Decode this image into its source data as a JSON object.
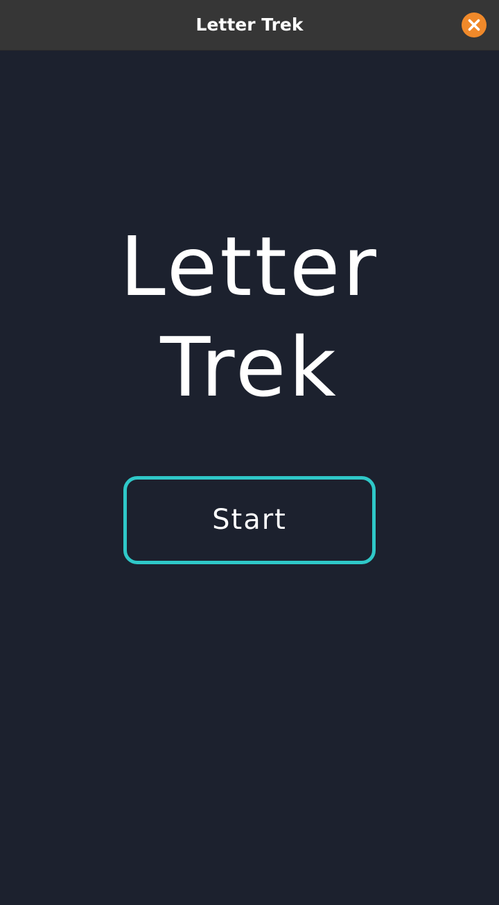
{
  "window": {
    "title": "Letter Trek",
    "close_icon": "close-icon",
    "close_color": "#f0892a"
  },
  "game": {
    "title_line1": "Letter",
    "title_line2": "Trek",
    "start_label": "Start",
    "accent_color": "#2fc8c8",
    "background_color": "#1c212e"
  }
}
